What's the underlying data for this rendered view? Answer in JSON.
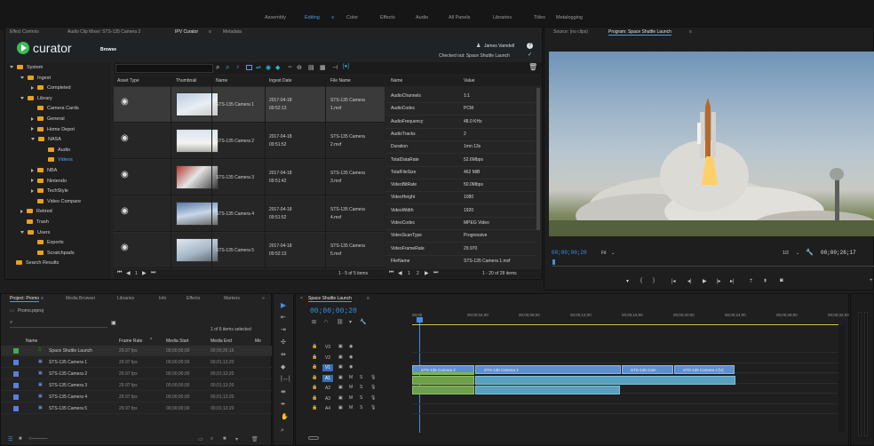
{
  "workspaces": [
    "Assembly",
    "Editing",
    "Color",
    "Effects",
    "Audio",
    "All Panels",
    "Libraries",
    "Titles",
    "Metalogging"
  ],
  "active_workspace": "Editing",
  "left_tabs": [
    "Effect Controls",
    "Audio Clip Mixer: STS-135 Camera 2",
    "IPV Curator",
    "Metadata"
  ],
  "active_left_tab": "IPV Curator",
  "monitor_tabs": [
    "Source: (no clips)",
    "Program: Space Shuttle Launch"
  ],
  "curator": {
    "logo": "curator",
    "browse": "Browse",
    "user": "James Varndell",
    "checked_out": "Checked out: Space Shuttle Launch"
  },
  "tree": [
    {
      "label": "System",
      "depth": 0,
      "expand": "down"
    },
    {
      "label": "Ingest",
      "depth": 1,
      "expand": "down"
    },
    {
      "label": "Completed",
      "depth": 2,
      "expand": "right"
    },
    {
      "label": "Library",
      "depth": 1,
      "expand": "down"
    },
    {
      "label": "Camera Cards",
      "depth": 2,
      "expand": ""
    },
    {
      "label": "General",
      "depth": 2,
      "expand": "right"
    },
    {
      "label": "Home Depot",
      "depth": 2,
      "expand": "right"
    },
    {
      "label": "NASA",
      "depth": 2,
      "expand": "down"
    },
    {
      "label": "Audio",
      "depth": 3,
      "expand": ""
    },
    {
      "label": "Videos",
      "depth": 3,
      "expand": "",
      "active": true
    },
    {
      "label": "NBA",
      "depth": 2,
      "expand": "right"
    },
    {
      "label": "Nintendo",
      "depth": 2,
      "expand": "right"
    },
    {
      "label": "TechStyle",
      "depth": 2,
      "expand": "right"
    },
    {
      "label": "Video Compare",
      "depth": 2,
      "expand": ""
    },
    {
      "label": "Retired",
      "depth": 1,
      "expand": "right"
    },
    {
      "label": "Trash",
      "depth": 1,
      "expand": ""
    },
    {
      "label": "Users",
      "depth": 1,
      "expand": "down"
    },
    {
      "label": "Exports",
      "depth": 2,
      "expand": ""
    },
    {
      "label": "Scratchpads",
      "depth": 2,
      "expand": ""
    },
    {
      "label": "Search Results",
      "depth": 0,
      "expand": ""
    }
  ],
  "asset_headers": [
    "Asset Type",
    "Thumbnail",
    "Name",
    "Ingest Date",
    "File Name"
  ],
  "assets": [
    {
      "name": "STS-135 Camera 1",
      "date": "2017-04-18",
      "time": "09:52:13",
      "file": "STS-135 Camera",
      "file2": "1.mxf"
    },
    {
      "name": "STS-135 Camera 2",
      "date": "2017-04-18",
      "time": "09:51:52",
      "file": "STS-135 Camera",
      "file2": "2.mxf"
    },
    {
      "name": "STS-135 Camera 3",
      "date": "2017-04-18",
      "time": "09:51:42",
      "file": "STS-135 Camera",
      "file2": "3.mxf"
    },
    {
      "name": "STS-135 Camera 4",
      "date": "2017-04-18",
      "time": "09:51:52",
      "file": "STS-135 Camera",
      "file2": "4.mxf"
    },
    {
      "name": "STS-135 Camera 5",
      "date": "2017-04-18",
      "time": "09:52:13",
      "file": "STS-135 Camera",
      "file2": "5.mxf"
    }
  ],
  "asset_pager": "1 - 5 of 5 items",
  "pager_page": "1",
  "meta_headers": [
    "Name",
    "Value"
  ],
  "meta": [
    {
      "k": "AudioChannels",
      "v": "1:1"
    },
    {
      "k": "AudioCodec",
      "v": "PCM"
    },
    {
      "k": "AudioFrequency",
      "v": "48.0 KHz"
    },
    {
      "k": "AudioTracks",
      "v": "2"
    },
    {
      "k": "Duration",
      "v": "1mn 13s"
    },
    {
      "k": "TotalDataRate",
      "v": "52.6Mbps"
    },
    {
      "k": "TotalFileSize",
      "v": "462 MiB"
    },
    {
      "k": "VideoBitRate",
      "v": "50.0Mbps"
    },
    {
      "k": "VideoHeight",
      "v": "1080"
    },
    {
      "k": "VideoWidth",
      "v": "1920"
    },
    {
      "k": "VideoCodec",
      "v": "MPEG Video"
    },
    {
      "k": "VideoScanType",
      "v": "Progressive"
    },
    {
      "k": "VideoFrameRate",
      "v": "29.970"
    },
    {
      "k": "FileName",
      "v": "STS-135 Camera 1.mxf"
    }
  ],
  "meta_pager": "1 - 20 of 28 items",
  "meta_pages": [
    "1",
    "2"
  ],
  "program": {
    "timecode_left": "00;00;00;20",
    "fit": "Fit",
    "ratio": "1/2",
    "timecode_right": "00;00;26;17"
  },
  "project": {
    "tabs": [
      "Project: Promo",
      "Media Browser",
      "Libraries",
      "Info",
      "Effects",
      "Markers"
    ],
    "file": "Promo.prproj",
    "selected": "1 of 6 items selected",
    "headers": [
      "Name",
      "Frame Rate",
      "Media Start",
      "Media End",
      "Me"
    ],
    "rows": [
      {
        "name": "Space Shuttle Launch",
        "fps": "29.97 fps",
        "start": "00;00;00;00",
        "end": "00;00;26;16",
        "color": "#3fae4a"
      },
      {
        "name": "STS-135 Camera 1",
        "fps": "29.97 fps",
        "start": "00;00;00;00",
        "end": "00;01;13;20",
        "color": "#5b7fd8"
      },
      {
        "name": "STS-135 Camera 2",
        "fps": "29.97 fps",
        "start": "00;00;00;00",
        "end": "00;01;13;20",
        "color": "#5b7fd8"
      },
      {
        "name": "STS-135 Camera 3",
        "fps": "29.97 fps",
        "start": "00;00;00;00",
        "end": "00;01;13;20",
        "color": "#5b7fd8"
      },
      {
        "name": "STS-135 Camera 4",
        "fps": "29.97 fps",
        "start": "00;00;00;00",
        "end": "00;01;13;20",
        "color": "#5b7fd8"
      },
      {
        "name": "STS-135 Camera 5",
        "fps": "29.97 fps",
        "start": "00;00;00;00",
        "end": "00;01;13;20",
        "color": "#5b7fd8"
      }
    ]
  },
  "timeline": {
    "seq_tab": "Space Shuttle Launch",
    "timecode": "00;00;00;20",
    "ruler": [
      "00;00",
      "00;00;04;00",
      "00;00;08;00",
      "00;00;12;00",
      "00;00;16;00",
      "00;00;20;00",
      "00;00;24;00",
      "00;00;28;00",
      "00;00;32;00"
    ],
    "tracks": [
      "V3",
      "V2",
      "V1",
      "A1",
      "A2",
      "A3",
      "A4"
    ],
    "clips": [
      "STS-135 Camera 2",
      "STS-135 Camera 1",
      "STS-135 Cam",
      "STS-135 Camera 4 [V]"
    ]
  }
}
